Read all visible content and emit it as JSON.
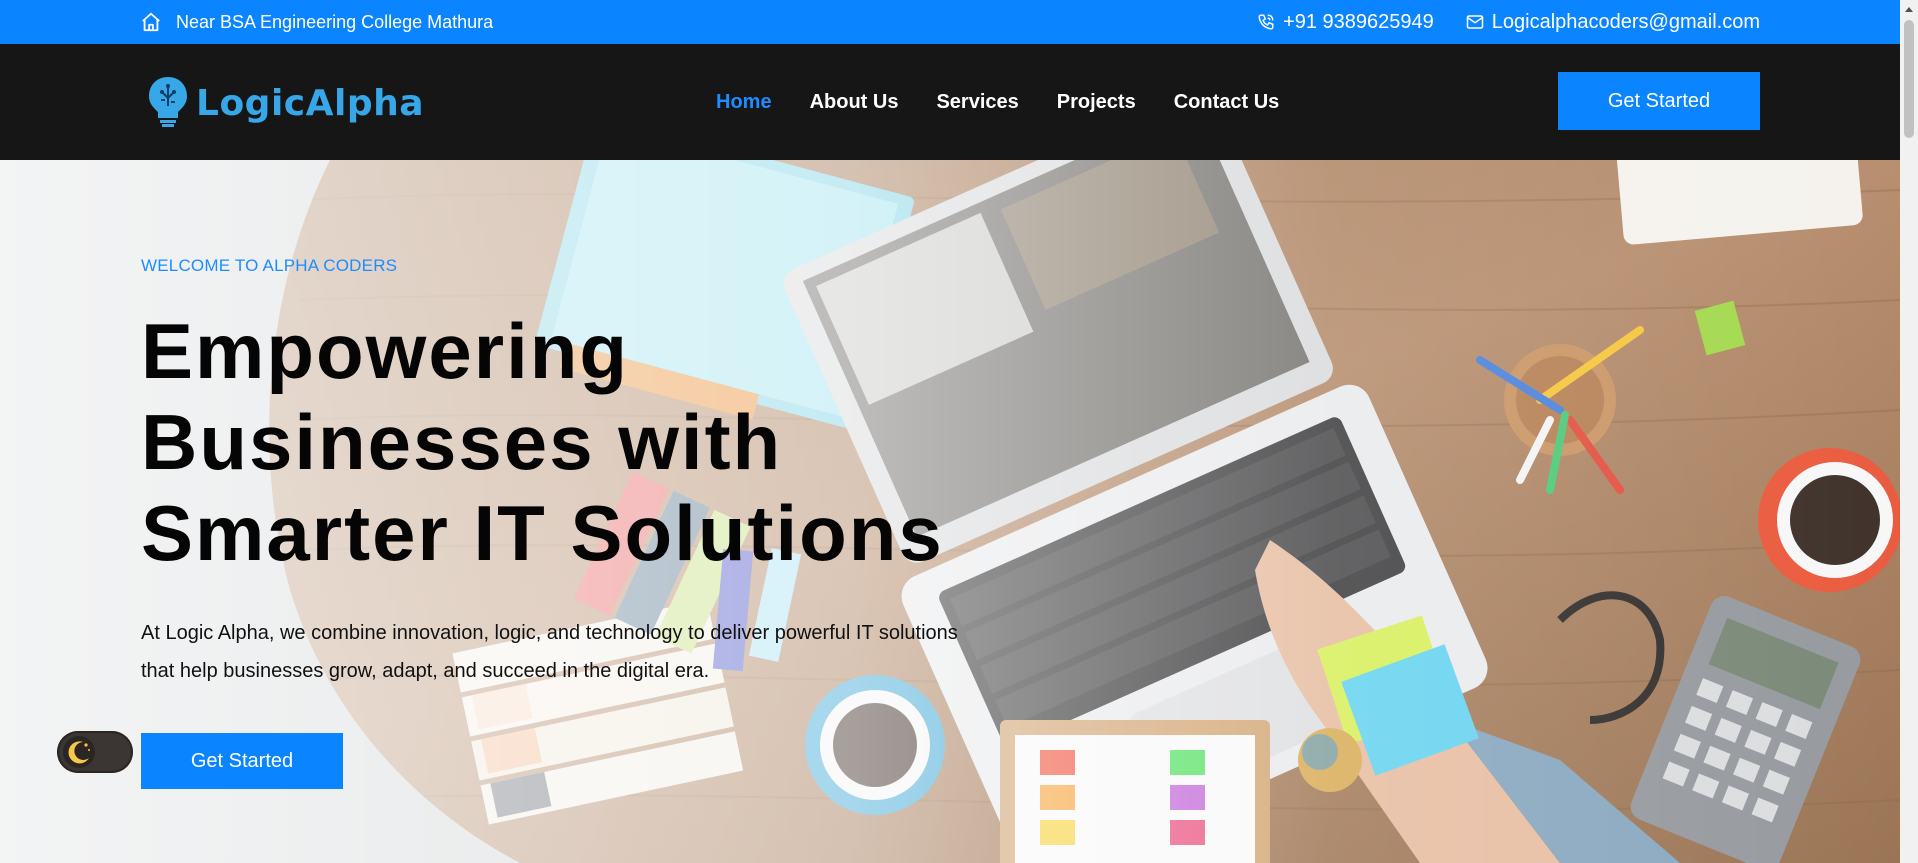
{
  "topbar": {
    "address": "Near BSA Engineering College Mathura",
    "phone": "+91 9389625949",
    "email": "Logicalphacoders@gmail.com",
    "address_icon": "home-icon",
    "phone_icon": "phone-icon",
    "email_icon": "mail-icon",
    "background": "#0a84ff"
  },
  "navbar": {
    "logo_text": "LogicAlpha",
    "links": [
      {
        "label": "Home",
        "active": true
      },
      {
        "label": "About Us",
        "active": false
      },
      {
        "label": "Services",
        "active": false
      },
      {
        "label": "Projects",
        "active": false
      },
      {
        "label": "Contact Us",
        "active": false
      }
    ],
    "cta_label": "Get Started",
    "background": "#161616",
    "active_color": "#1e8cff"
  },
  "hero": {
    "eyebrow": "WELCOME TO ALPHA CODERS",
    "headline": [
      "Empowering",
      "Businesses with",
      "Smarter IT Solutions"
    ],
    "description": "At Logic Alpha, we combine innovation, logic, and technology to deliver powerful IT solutions that help businesses grow, adapt, and succeed in the digital era.",
    "cta_label": "Get Started",
    "accent": "#0a84ff"
  },
  "theme_toggle": {
    "icon": "moon-icon",
    "mode": "dark"
  }
}
